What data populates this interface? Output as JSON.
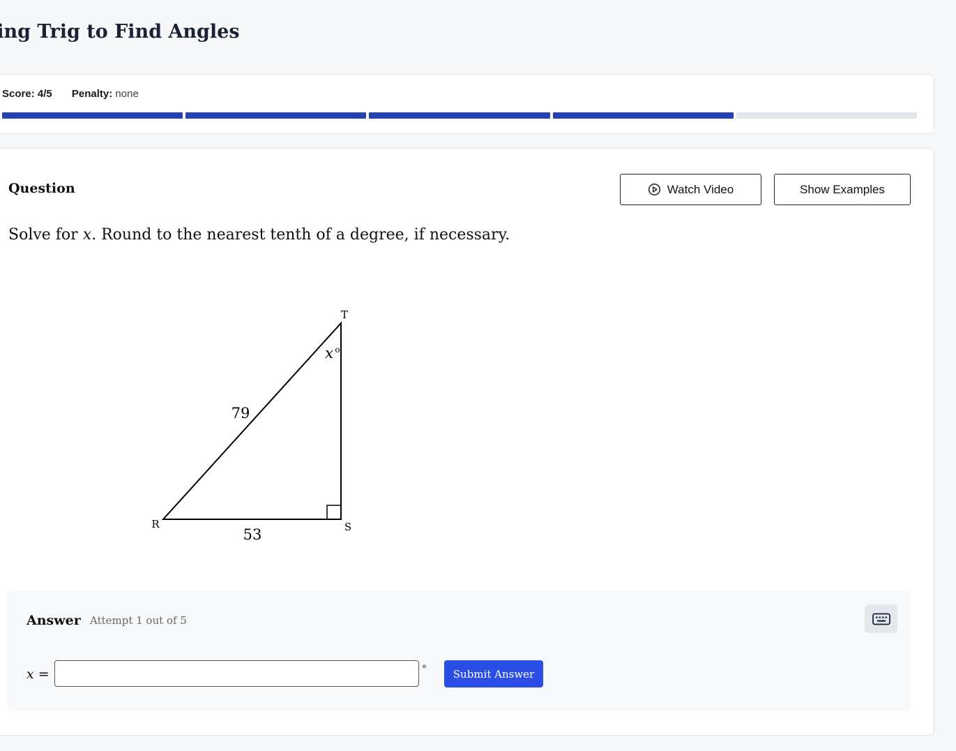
{
  "page": {
    "title": "sing Trig to Find Angles"
  },
  "score": {
    "score_label": "Score:",
    "score_value": "4/5",
    "penalty_label": "Penalty:",
    "penalty_value": "none",
    "progress_segments": [
      "complete",
      "complete",
      "complete",
      "complete",
      "incomplete"
    ],
    "complete_color": "#2541b2",
    "incomplete_color": "#e2e5ea"
  },
  "question": {
    "heading": "Question",
    "watch_video_label": "Watch Video",
    "show_examples_label": "Show Examples",
    "prompt_before": "Solve for ",
    "prompt_var": "x",
    "prompt_after": ". Round to the nearest tenth of a degree, if necessary.",
    "diagram": {
      "vertex_t": "T",
      "vertex_r": "R",
      "vertex_s": "S",
      "hypotenuse": "79",
      "base": "53",
      "angle_var": "x",
      "angle_unit": "o"
    }
  },
  "answer": {
    "heading": "Answer",
    "attempt_text": "Attempt 1 out of 5",
    "var_name": "x",
    "equals": " =",
    "input_value": "",
    "unit": "°",
    "submit_label": "Submit Answer"
  }
}
